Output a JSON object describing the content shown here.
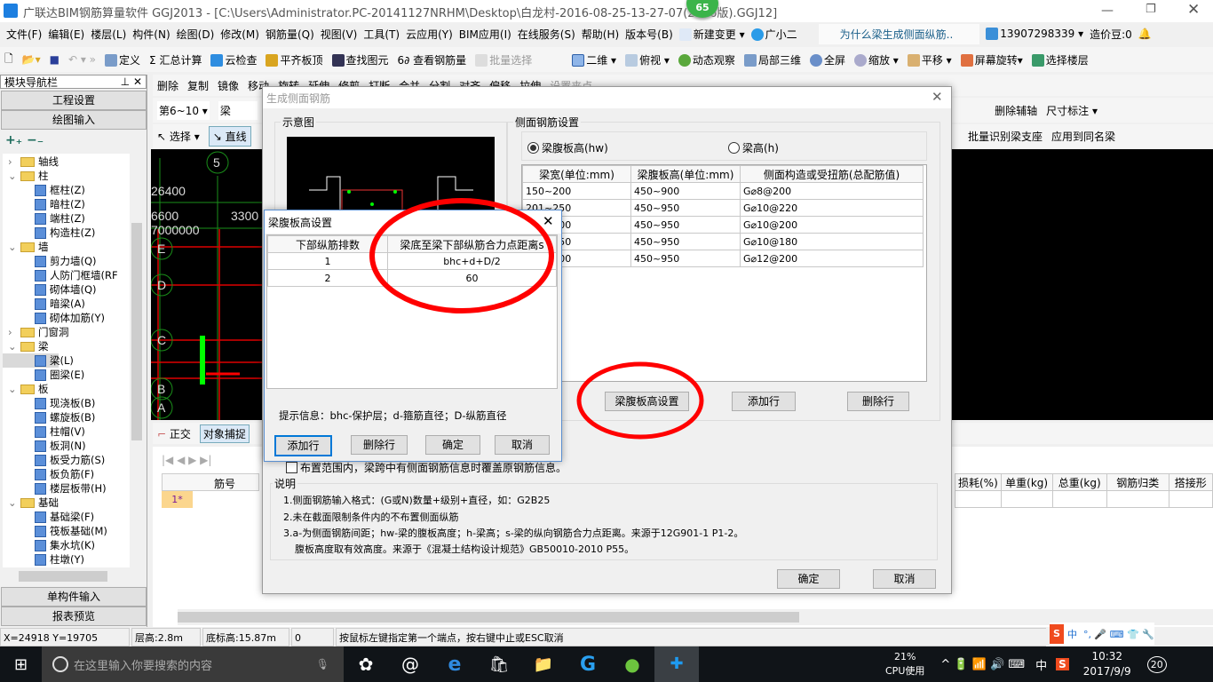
{
  "app": {
    "title": "广联达BIM钢筋算量软件 GGJ2013 - [C:\\Users\\Administrator.PC-20141127NRHM\\Desktop\\白龙村-2016-08-25-13-27-07(2166版).GGJ12]",
    "badge": "65"
  },
  "menu": [
    "文件(F)",
    "编辑(E)",
    "楼层(L)",
    "构件(N)",
    "绘图(D)",
    "修改(M)",
    "钢筋量(Q)",
    "视图(V)",
    "工具(T)",
    "云应用(Y)",
    "BIM应用(I)",
    "在线服务(S)",
    "帮助(H)",
    "版本号(B)",
    "新建变更",
    "广小二"
  ],
  "menu_right": {
    "question": "为什么梁生成侧面纵筋..",
    "phone": "13907298339",
    "beans": "造价豆:0"
  },
  "toolbar1": [
    "定义",
    "汇总计算",
    "云检查",
    "平齐板顶",
    "查找图元",
    "查看钢筋量",
    "批量选择",
    "二维",
    "俯视",
    "动态观察",
    "局部三维",
    "全屏",
    "缩放",
    "平移",
    "屏幕旋转",
    "选择楼层"
  ],
  "toolbar2": [
    "删除",
    "复制",
    "镜像",
    "移动",
    "旋转",
    "延伸",
    "修剪",
    "打断",
    "合并",
    "分割",
    "对齐",
    "偏移",
    "拉伸",
    "设置夹点"
  ],
  "toolbar3": {
    "floor": "第6~10",
    "type": "梁",
    "right": [
      "删除辅轴",
      "尺寸标注"
    ]
  },
  "toolbar4": {
    "select": "选择",
    "line": "直线",
    "right": [
      "批量识别梁支座",
      "应用到同名梁"
    ]
  },
  "nav": {
    "title": "模块导航栏",
    "btn_top": [
      "工程设置",
      "绘图输入"
    ],
    "btn_bottom": [
      "单构件输入",
      "报表预览"
    ],
    "tree": [
      {
        "l": 0,
        "t": "轴线",
        "f": 1,
        "o": 0
      },
      {
        "l": 0,
        "t": "柱",
        "f": 1,
        "o": 1
      },
      {
        "l": 1,
        "t": "框柱(Z)"
      },
      {
        "l": 1,
        "t": "暗柱(Z)"
      },
      {
        "l": 1,
        "t": "端柱(Z)"
      },
      {
        "l": 1,
        "t": "构造柱(Z)"
      },
      {
        "l": 0,
        "t": "墙",
        "f": 1,
        "o": 1
      },
      {
        "l": 1,
        "t": "剪力墙(Q)"
      },
      {
        "l": 1,
        "t": "人防门框墙(RF"
      },
      {
        "l": 1,
        "t": "砌体墙(Q)"
      },
      {
        "l": 1,
        "t": "暗梁(A)"
      },
      {
        "l": 1,
        "t": "砌体加筋(Y)"
      },
      {
        "l": 0,
        "t": "门窗洞",
        "f": 1,
        "o": 0
      },
      {
        "l": 0,
        "t": "梁",
        "f": 1,
        "o": 1
      },
      {
        "l": 1,
        "t": "梁(L)",
        "sel": 1
      },
      {
        "l": 1,
        "t": "圈梁(E)"
      },
      {
        "l": 0,
        "t": "板",
        "f": 1,
        "o": 1
      },
      {
        "l": 1,
        "t": "现浇板(B)"
      },
      {
        "l": 1,
        "t": "螺旋板(B)"
      },
      {
        "l": 1,
        "t": "柱帽(V)"
      },
      {
        "l": 1,
        "t": "板洞(N)"
      },
      {
        "l": 1,
        "t": "板受力筋(S)"
      },
      {
        "l": 1,
        "t": "板负筋(F)"
      },
      {
        "l": 1,
        "t": "楼层板带(H)"
      },
      {
        "l": 0,
        "t": "基础",
        "f": 1,
        "o": 1
      },
      {
        "l": 1,
        "t": "基础梁(F)"
      },
      {
        "l": 1,
        "t": "筏板基础(M)"
      },
      {
        "l": 1,
        "t": "集水坑(K)"
      },
      {
        "l": 1,
        "t": "柱墩(Y)"
      }
    ]
  },
  "canvas": {
    "axes": [
      "5",
      "E",
      "D",
      "C",
      "B",
      "A"
    ],
    "dims": [
      "26400",
      "6600",
      "3300",
      "7000000"
    ]
  },
  "snap": {
    "ortho": "正交",
    "snap": "对象捕捉"
  },
  "grid": {
    "left_cols": [
      "筋号"
    ],
    "row": "1*",
    "right_cols": [
      "损耗(%)",
      "单重(kg)",
      "总重(kg)",
      "钢筋归类",
      "搭接形"
    ]
  },
  "status": {
    "coord": "X=24918 Y=19705",
    "floor_h": "层高:2.8m",
    "base_h": "底标高:15.87m",
    "zero": "0",
    "hint": "按鼠标左键指定第一个端点，按右键中止或ESC取消"
  },
  "dlg": {
    "title": "生成侧面钢筋",
    "diagram": "示意图",
    "settings": "侧面钢筋设置",
    "radio1": "梁腹板高(hw)",
    "radio2": "梁高(h)",
    "radio1_checked": true,
    "cols": [
      "梁宽(单位:mm)",
      "梁腹板高(单位:mm)",
      "侧面构造或受扭筋(总配筋值)"
    ],
    "rows": [
      [
        "150~200",
        "450~900",
        "G⌀8@200"
      ],
      [
        "201~250",
        "450~950",
        "G⌀10@220"
      ],
      [
        "251~300",
        "450~950",
        "G⌀10@200"
      ],
      [
        "301~350",
        "450~950",
        "G⌀10@180"
      ],
      [
        "351~400",
        "450~950",
        "G⌀12@200"
      ]
    ],
    "btn_web": "梁腹板高设置",
    "btn_add": "添加行",
    "btn_del": "删除行",
    "checkbox": "布置范围内，梁跨中有侧面钢筋信息时覆盖原钢筋信息。",
    "checked": false,
    "notes_title": "说明",
    "notes": [
      "1.侧面钢筋输入格式：(G或N)数量+级别+直径，如：G2B25",
      "2.未在截面限制条件内的不布置侧面纵筋",
      "3.a-为侧面钢筋间距；hw-梁的腹板高度；h-梁高；s-梁的纵向钢筋合力点距离。来源于12G901-1 P1-2。",
      "腹板高度取有效高度。来源于《混凝土结构设计规范》GB50010-2010 P55。"
    ],
    "ok": "确定",
    "cancel": "取消"
  },
  "sub": {
    "title": "梁腹板高设置",
    "cols": [
      "下部纵筋排数",
      "梁底至梁下部纵筋合力点距离s"
    ],
    "rows": [
      [
        "1",
        "bhc+d+D/2"
      ],
      [
        "2",
        "60"
      ]
    ],
    "hint": "提示信息：bhc-保护层；d-箍筋直径；D-纵筋直径",
    "add": "添加行",
    "del": "删除行",
    "ok": "确定",
    "cancel": "取消"
  },
  "annotation_color": "#ff0000",
  "taskbar": {
    "search": "在这里输入你要搜索的内容",
    "cpu": "21%",
    "cpu_label": "CPU使用",
    "ime": "中",
    "time": "10:32",
    "date": "2017/9/9",
    "notif": "20"
  },
  "ime_bar": {
    "lang": "中"
  }
}
